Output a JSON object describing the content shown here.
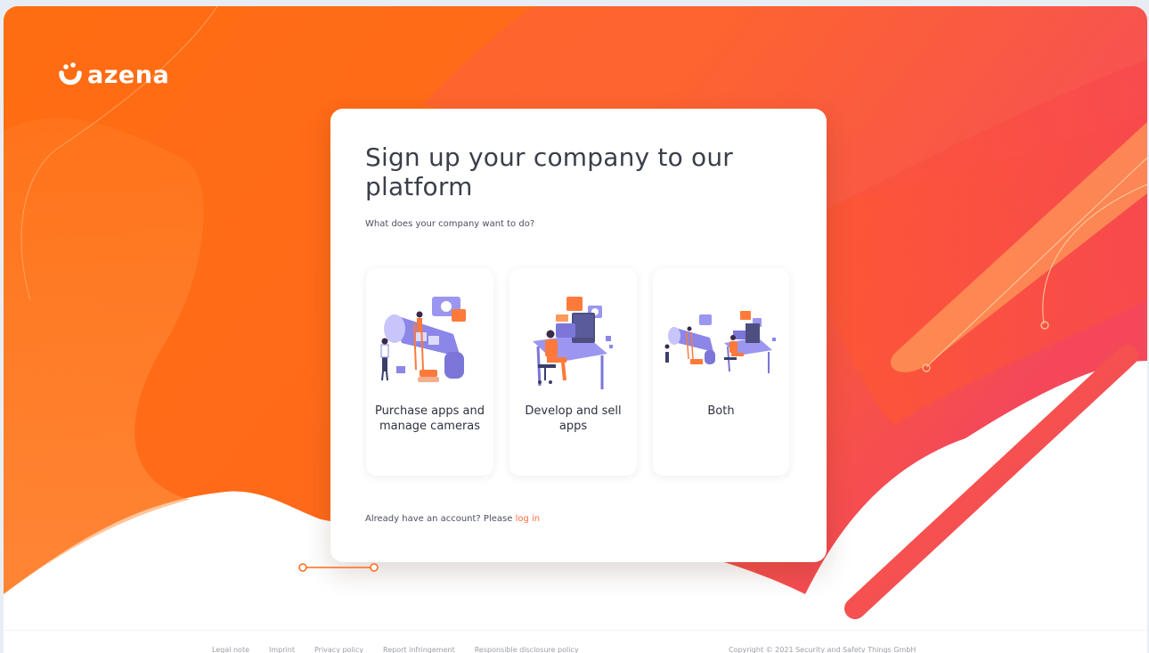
{
  "brand": {
    "name": "azena"
  },
  "signup": {
    "title": "Sign up your company to our platform",
    "subtitle": "What does your company want to do?",
    "options": [
      {
        "label": "Purchase apps and manage cameras",
        "illustration": "camera-illustration-icon"
      },
      {
        "label": "Develop and sell apps",
        "illustration": "developer-illustration-icon"
      },
      {
        "label": "Both",
        "illustration": "combined-illustration-icon"
      }
    ],
    "login_prompt": "Already have an account? Please",
    "login_link": "log in"
  },
  "footer": {
    "links": [
      "Legal note",
      "Imprint",
      "Privacy policy",
      "Report infringement",
      "Responsible disclosure policy"
    ],
    "copyright": "Copyright © 2021 Security and Safety Things GmbH"
  },
  "colors": {
    "orange": "#ff6a1a",
    "orange_light": "#ff8a3c",
    "pink": "#f2456b",
    "link": "#ff6a3d",
    "illustration_purple": "#8b86e8"
  }
}
